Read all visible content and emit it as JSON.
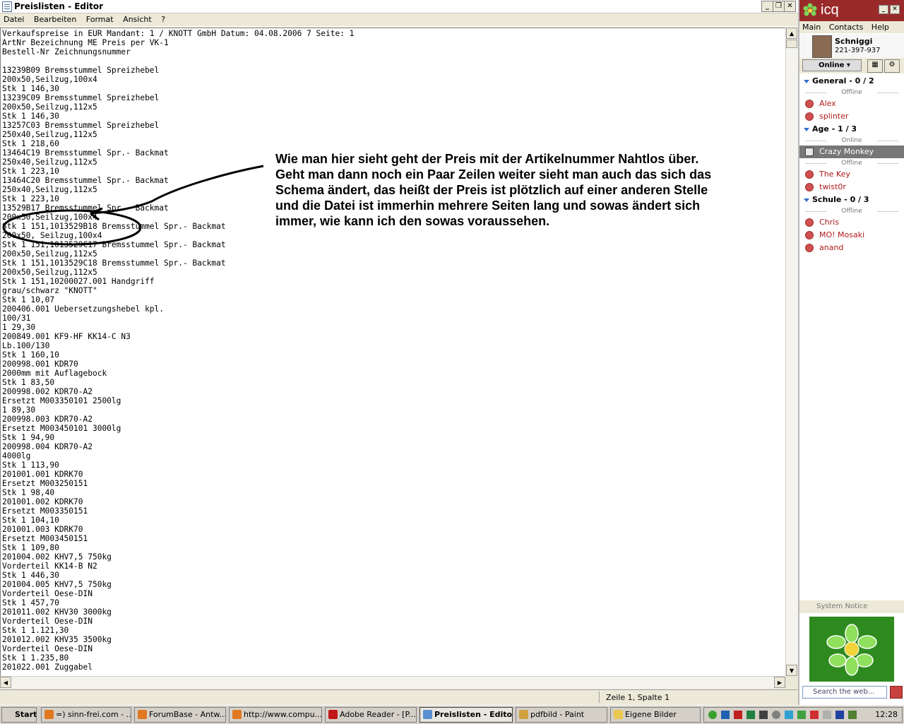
{
  "notepad": {
    "title": "Preislisten - Editor",
    "menu": [
      "Datei",
      "Bearbeiten",
      "Format",
      "Ansicht",
      "?"
    ],
    "content_lines": [
      "Verkaufspreise in EUR Mandant: 1 / KNOTT GmbH Datum: 04.08.2006 7 Seite: 1",
      "ArtNr Bezeichnung ME Preis per VK-1",
      "Bestell-Nr Zeichnungsnummer",
      "",
      "13239B09 Bremsstummel Spreizhebel",
      "200x50,Seilzug,100x4",
      "Stk 1 146,30",
      "13239C09 Bremsstummel Spreizhebel",
      "200x50,Seilzug,112x5",
      "Stk 1 146,30",
      "13257C03 Bremsstummel Spreizhebel",
      "250x40,Seilzug,112x5",
      "Stk 1 218,60",
      "13464C19 Bremsstummel Spr.- Backmat",
      "250x40,Seilzug,112x5",
      "Stk 1 223,10",
      "13464C20 Bremsstummel Spr.- Backmat",
      "250x40,Seilzug,112x5",
      "Stk 1 223,10",
      "13529B17 Bremsstummel Spr.- Backmat",
      "200x50,Seilzug,100x4",
      "Stk 1 151,1013529B18 Bremsstummel Spr.- Backmat",
      "200x50, Seilzug,100x4",
      "Stk 1 151,1013529C17 Bremsstummel Spr.- Backmat",
      "200x50,Seilzug,112x5",
      "Stk 1 151,1013529C18 Bremsstummel Spr.- Backmat",
      "200x50,Seilzug,112x5",
      "Stk 1 151,10200027.001 Handgriff",
      "grau/schwarz \"KNOTT\"",
      "Stk 1 10,07",
      "200406.001 Uebersetzungshebel kpl.",
      "100/31",
      "1 29,30",
      "200849.001 KF9-HF KK14-C N3",
      "Lb.100/130",
      "Stk 1 160,10",
      "200998.001 KDR70",
      "2000mm mit Auflagebock",
      "Stk 1 83,50",
      "200998.002 KDR70-A2",
      "Ersetzt M003350101 2500lg",
      "1 89,30",
      "200998.003 KDR70-A2",
      "Ersetzt M003450101 3000lg",
      "Stk 1 94,90",
      "200998.004 KDR70-A2",
      "4000lg",
      "Stk 1 113,90",
      "201001.001 KDRK70",
      "Ersetzt M003250151",
      "Stk 1 98,40",
      "201001.002 KDRK70",
      "Ersetzt M003350151",
      "Stk 1 104,10",
      "201001.003 KDRK70",
      "Ersetzt M003450151",
      "Stk 1 109,80",
      "201004.002 KHV7,5 750kg",
      "Vorderteil KK14-B N2",
      "Stk 1 446,30",
      "201004.005 KHV7,5 750kg",
      "Vorderteil Oese-DIN",
      "Stk 1 457,70",
      "201011.002 KHV30 3000kg",
      "Vorderteil Oese-DIN",
      "Stk 1 1.121,30",
      "201012.002 KHV35 3500kg",
      "Vorderteil Oese-DIN",
      "Stk 1 1.235,80",
      "201022.001 Zuggabel"
    ],
    "status_position": "Zeile 1, Spalte 1",
    "annotation": "Wie man hier sieht geht der Preis mit der Artikelnummer Nahtlos über.  Geht man dann noch ein Paar Zeilen weiter sieht man auch das sich das Schema ändert, das heißt der Preis ist plötzlich auf einer anderen Stelle und die Datei ist immerhin mehrere Seiten lang und sowas ändert sich immer, wie kann ich den sowas voraussehen."
  },
  "icq": {
    "title": "icq",
    "menu": [
      "Main",
      "Contacts",
      "Help"
    ],
    "user_name": "Schniggi",
    "user_number": "221-397-937",
    "status": "Online",
    "groups": [
      {
        "name": "General",
        "count": "0 / 2",
        "sub": "Offline",
        "contacts": [
          "Alex",
          "splinter"
        ]
      },
      {
        "name": "Age",
        "count": "1 / 3",
        "sub": "Online",
        "online": [
          "Crazy Monkey"
        ],
        "sub2": "Offline",
        "contacts": [
          "The Key",
          "twist0r"
        ]
      },
      {
        "name": "Schule",
        "count": "0 / 3",
        "sub": "Offline",
        "contacts": [
          "Chris",
          "MO! Mosaki",
          "anand"
        ]
      }
    ],
    "system_notice": "System Notice",
    "search_placeholder": "Search the web...",
    "colors": {
      "header": "#9a2a2a",
      "accent": "#2e8a1e"
    }
  },
  "taskbar": {
    "start": "Start",
    "items": [
      "=) sinn-frei.com - ...",
      "ForumBase - Antw...",
      "http://www.compu...",
      "Adobe Reader - [P...",
      "Preislisten - Editor",
      "pdfbild - Paint",
      "Eigene Bilder"
    ],
    "active_index": 4,
    "clock": "12:28"
  }
}
